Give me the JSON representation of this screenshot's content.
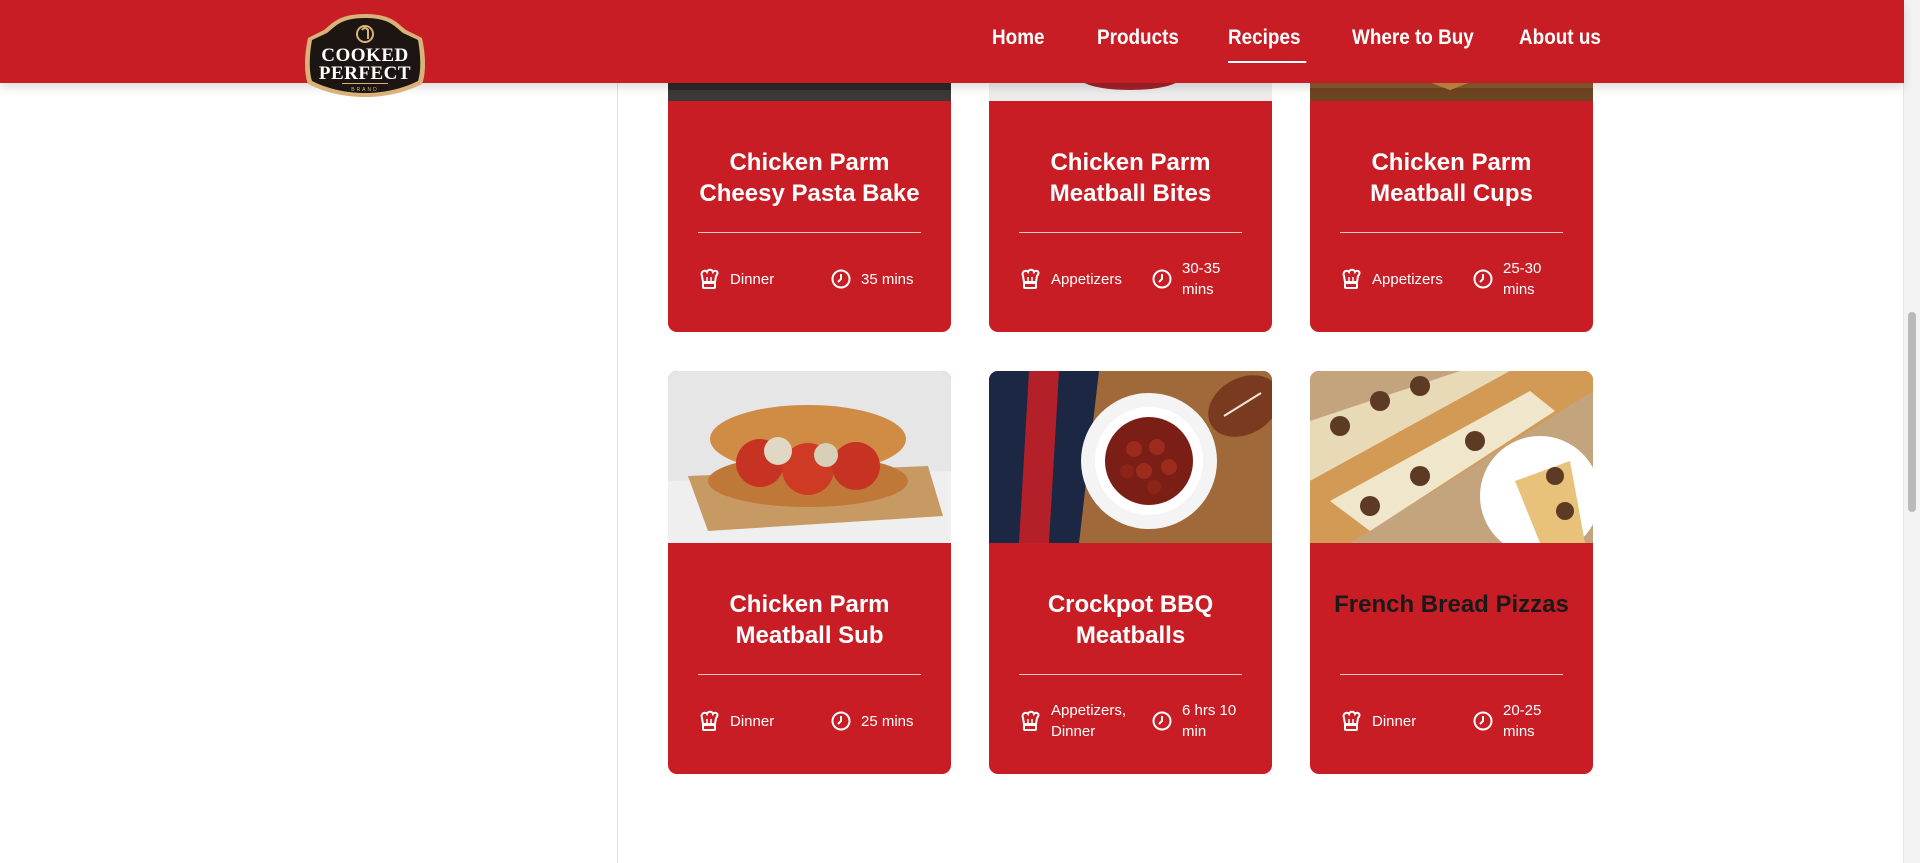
{
  "brand": {
    "logo_top": "Cooked",
    "logo_bottom": "Perfect",
    "logo_sub": "BRAND"
  },
  "nav": [
    {
      "label": "Home"
    },
    {
      "label": "Products"
    },
    {
      "label": "Recipes",
      "active": true
    },
    {
      "label": "Where to Buy"
    },
    {
      "label": "About us"
    }
  ],
  "colors": {
    "brand_red": "#c81d25",
    "white": "#ffffff"
  },
  "recipes": [
    {
      "title": "Chicken Parm Cheesy Pasta Bake",
      "category": "Dinner",
      "time": "35 mins"
    },
    {
      "title": "Chicken Parm Meatball Bites",
      "category": "Appetizers",
      "time": "30-35 mins"
    },
    {
      "title": "Chicken Parm Meatball Cups",
      "category": "Appetizers",
      "time": "25-30 mins"
    },
    {
      "title": "Chicken Parm Meatball Sub",
      "category": "Dinner",
      "time": "25 mins"
    },
    {
      "title": "Crockpot BBQ Meatballs",
      "category": "Appetizers, Dinner",
      "time": "6 hrs 10 min"
    },
    {
      "title": "French Bread Pizzas",
      "category": "Dinner",
      "time": "20-25 mins"
    }
  ],
  "icons": {
    "category": "chef-hat-icon",
    "time": "clock-icon"
  }
}
